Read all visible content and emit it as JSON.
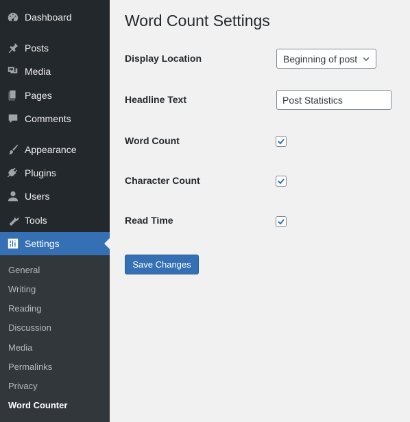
{
  "sidebar": {
    "items": [
      {
        "label": "Dashboard",
        "icon": "dashboard-icon"
      },
      {
        "label": "Posts",
        "icon": "pin-icon"
      },
      {
        "label": "Media",
        "icon": "media-icon"
      },
      {
        "label": "Pages",
        "icon": "pages-icon"
      },
      {
        "label": "Comments",
        "icon": "comment-icon"
      },
      {
        "label": "Appearance",
        "icon": "paintbrush-icon"
      },
      {
        "label": "Plugins",
        "icon": "plug-icon"
      },
      {
        "label": "Users",
        "icon": "user-icon"
      },
      {
        "label": "Tools",
        "icon": "wrench-icon"
      },
      {
        "label": "Settings",
        "icon": "settings-sliders-icon",
        "active": true
      }
    ],
    "submenu": [
      {
        "label": "General"
      },
      {
        "label": "Writing"
      },
      {
        "label": "Reading"
      },
      {
        "label": "Discussion"
      },
      {
        "label": "Media"
      },
      {
        "label": "Permalinks"
      },
      {
        "label": "Privacy"
      },
      {
        "label": "Word Counter",
        "current": true
      }
    ]
  },
  "main": {
    "title": "Word Count Settings",
    "fields": {
      "display_location": {
        "label": "Display Location",
        "value": "Beginning of post"
      },
      "headline_text": {
        "label": "Headline Text",
        "value": "Post Statistics"
      },
      "word_count": {
        "label": "Word Count",
        "checked": true
      },
      "character_count": {
        "label": "Character Count",
        "checked": true
      },
      "read_time": {
        "label": "Read Time",
        "checked": true
      }
    },
    "save_label": "Save Changes"
  },
  "colors": {
    "sidebar_bg": "#23282d",
    "submenu_bg": "#32373c",
    "accent": "#3470b3",
    "content_bg": "#f1f1f1"
  }
}
